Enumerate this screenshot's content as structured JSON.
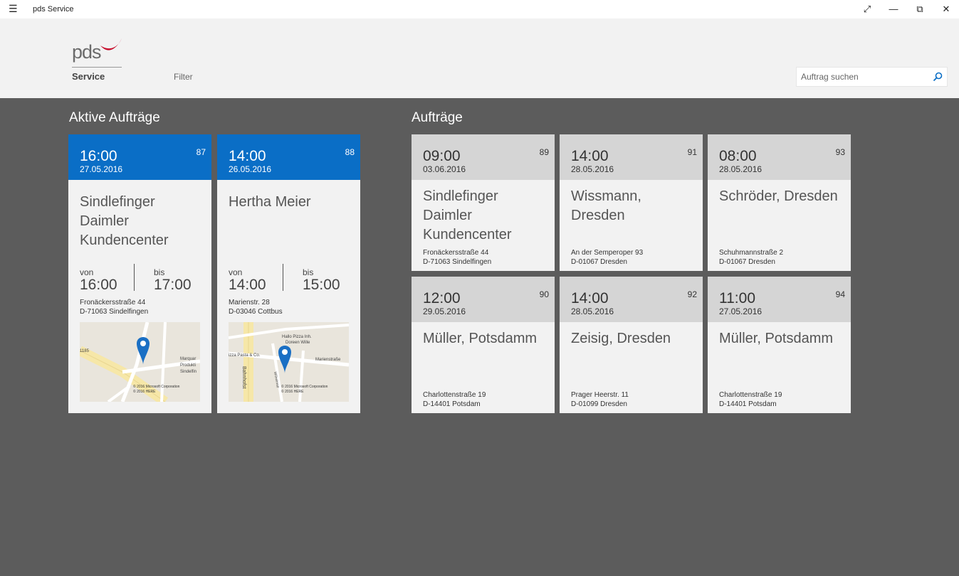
{
  "window": {
    "title": "pds Service",
    "menu_icon": "hamburger-icon",
    "controls": [
      "expand-icon",
      "minimize-icon",
      "restore-icon",
      "close-icon"
    ]
  },
  "header": {
    "logo_text": "pds",
    "logo_subtitle": "Service",
    "filter_label": "Filter",
    "search_placeholder": "Auftrag suchen",
    "accent_color": "#0a6ec6",
    "logo_swoosh_color": "#c8102e"
  },
  "active": {
    "heading": "Aktive Aufträge",
    "cards": [
      {
        "time": "16:00",
        "date": "27.05.2016",
        "number": "87",
        "name": "Sindlefinger Daimler Kundencenter",
        "von_label": "von",
        "von": "16:00",
        "bis_label": "bis",
        "bis": "17:00",
        "street": "Fronäckersstraße 44",
        "city": "D-71063 Sindelfingen",
        "map_labels": [
          "1185",
          "Marquar",
          "Produkti",
          "Sindelfin",
          "© 2016 Microsoft Corporation",
          "© 2016 HERE"
        ]
      },
      {
        "time": "14:00",
        "date": "26.05.2016",
        "number": "88",
        "name": "Hertha Meier",
        "von_label": "von",
        "von": "14:00",
        "bis_label": "bis",
        "bis": "15:00",
        "street": "Marienstr. 28",
        "city": "D-03046 Cottbus",
        "map_labels": [
          "Hallo Pizza Inh.",
          "Doreen Wille",
          "izza Pasta & Co.",
          "Marienstraße",
          "Bahnhofst",
          "Wilhelmstr",
          "© 2016 Microsoft Corporation",
          "© 2016 HERE"
        ]
      }
    ]
  },
  "orders": {
    "heading": "Aufträge",
    "cards": [
      {
        "time": "09:00",
        "date": "03.06.2016",
        "number": "89",
        "name": "Sindlefinger Daimler Kundencenter",
        "street": "Fronäckersstraße 44",
        "city": "D-71063 Sindelfingen"
      },
      {
        "time": "14:00",
        "date": "28.05.2016",
        "number": "91",
        "name": "Wissmann, Dresden",
        "street": "An der Semperoper 93",
        "city": "D-01067 Dresden"
      },
      {
        "time": "08:00",
        "date": "28.05.2016",
        "number": "93",
        "name": "Schröder, Dresden",
        "street": "Schuhmannstraße 2",
        "city": "D-01067 Dresden"
      },
      {
        "time": "12:00",
        "date": "29.05.2016",
        "number": "90",
        "name": "Müller, Potsdamm",
        "street": "Charlottenstraße 19",
        "city": "D-14401 Potsdam"
      },
      {
        "time": "14:00",
        "date": "28.05.2016",
        "number": "92",
        "name": "Zeisig, Dresden",
        "street": "Prager Heerstr. 11",
        "city": "D-01099 Dresden"
      },
      {
        "time": "11:00",
        "date": "27.05.2016",
        "number": "94",
        "name": "Müller, Potsdamm",
        "street": "Charlottenstraße 19",
        "city": "D-14401 Potsdam"
      }
    ]
  }
}
